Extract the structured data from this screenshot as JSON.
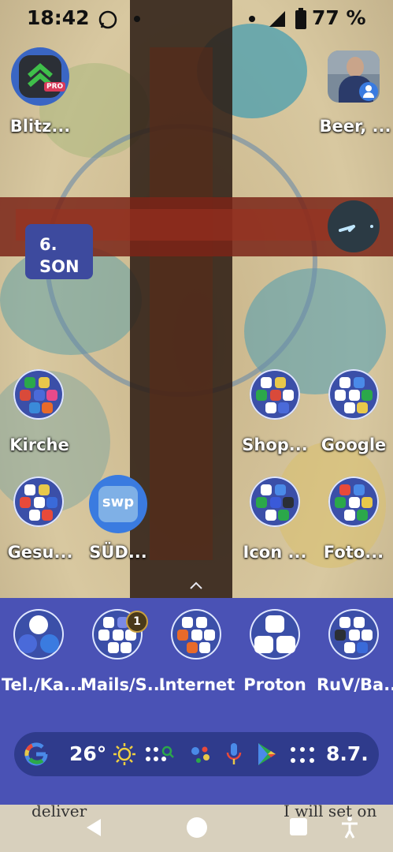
{
  "status_bar": {
    "time": "18:42",
    "battery_percent": "77 %",
    "icons": [
      "whatsapp-icon",
      "dot-icon",
      "dot-icon",
      "signal-icon",
      "battery-icon"
    ]
  },
  "home": {
    "apps": {
      "blitz": "Blitz...",
      "beer": "Beer, ...",
      "kirche": "Kirche",
      "shop": "Shop...",
      "google": "Google",
      "gesu": "Gesu...",
      "sud": "SÜD...",
      "icon": "Icon ...",
      "foto": "Foto..."
    },
    "calendar_widget": {
      "day": "6.",
      "weekday": "SON"
    },
    "swp_logo_text": "swp",
    "blitz_badge": "PRO"
  },
  "dock": {
    "items": [
      {
        "label": "Tel./Ka..."
      },
      {
        "label": "Mails/S...",
        "badge": "1"
      },
      {
        "label": "Internet"
      },
      {
        "label": "Proton"
      },
      {
        "label": "RuV/Ba..."
      }
    ]
  },
  "search_bar": {
    "temperature": "26°",
    "date": "8.7."
  },
  "wallpaper_text": {
    "left": "deliver",
    "right": "I will set on"
  },
  "colors": {
    "dock": "#4a52b5",
    "folder": "#3b4fa8",
    "search": "#2f3b8c"
  }
}
